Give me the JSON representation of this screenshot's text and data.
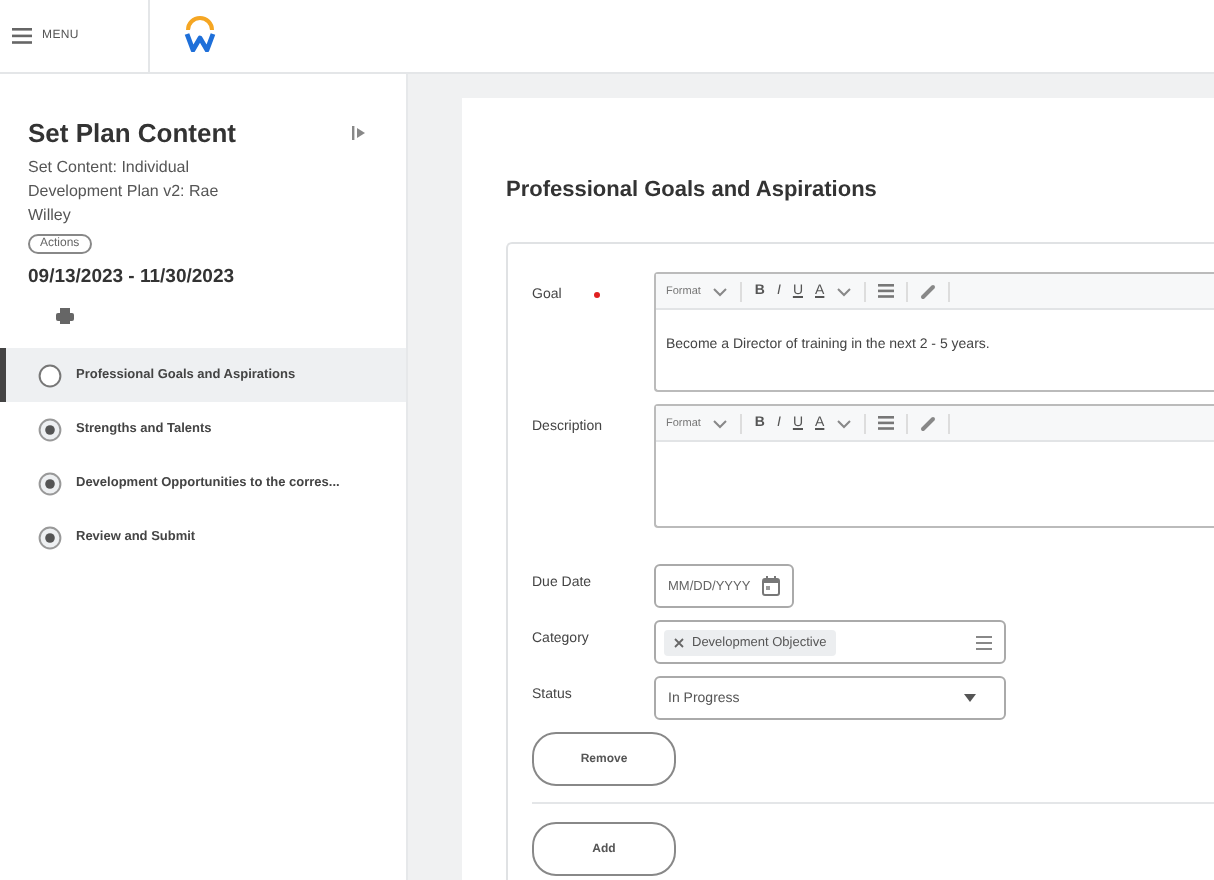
{
  "top_bar": {
    "menu_label": "MENU"
  },
  "sidebar": {
    "title": "Set Plan Content",
    "subtitle": "Set Content: Individual Development Plan v2: Rae Willey",
    "actions_button": "Actions",
    "date_range": "09/13/2023 - 11/30/2023",
    "steps": [
      {
        "label": "Professional Goals and Aspirations",
        "selected": true
      },
      {
        "label": "Strengths and Talents",
        "selected": false
      },
      {
        "label": "Development Opportunities to the corres...",
        "selected": false
      },
      {
        "label": "Review and Submit",
        "selected": false
      }
    ]
  },
  "section": {
    "heading": "Professional Goals and Aspirations",
    "fields": [
      {
        "kind": "rich_text",
        "label": "Goal",
        "required": true,
        "toolbar": [
          "Format",
          "B",
          "I",
          "U",
          "A"
        ],
        "value": "Become a Director of training in the next 2 - 5 years."
      },
      {
        "kind": "rich_text",
        "label": "Description",
        "required": false,
        "toolbar": [
          "Format",
          "B",
          "I",
          "U",
          "A"
        ]
      },
      {
        "kind": "date",
        "label": "Due Date",
        "required": false,
        "placeholder": "MM/DD/YYYY"
      },
      {
        "kind": "multiselect",
        "label": "Category",
        "required": false,
        "tags": [
          "Development Objective"
        ]
      },
      {
        "kind": "select",
        "label": "Status",
        "required": false,
        "value": "In Progress"
      }
    ],
    "remove_button": "Remove"
  },
  "add_button": "Add"
}
